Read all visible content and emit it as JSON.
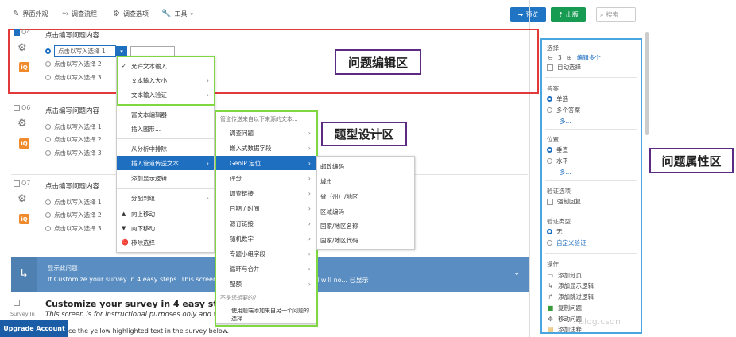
{
  "toolbar": {
    "look_feel": "界面外观",
    "survey_flow": "调查流程",
    "survey_options": "调查选项",
    "tools": "工具",
    "preview": "预览",
    "publish": "出版",
    "search_placeholder": "搜索"
  },
  "questions": [
    {
      "num": "Q4",
      "text": "点击编写问题内容",
      "choices": [
        "点击以写入选择 1",
        "点击以写入选择 2",
        "点击以写入选择 3"
      ]
    },
    {
      "num": "Q6",
      "text": "点击编写问题内容",
      "choices": [
        "点击以写入选择 1",
        "点击以写入选择 2",
        "点击以写入选择 3"
      ]
    },
    {
      "num": "Q7",
      "text": "点击编写问题内容",
      "choices": [
        "点击以写入选择 1",
        "点击以写入选择 2",
        "点击以写入选择 3"
      ]
    }
  ],
  "iq_badge": "iQ",
  "context_menu": {
    "allow_text": "允许文本输入",
    "text_size": "文本输入大小",
    "text_validation": "文本输入验证",
    "rich_editor": "富文本编辑器",
    "insert_graphic": "插入图形...",
    "remove_from_analysis": "从分析中排除",
    "insert_piped_text": "插入管道传送文本",
    "add_display_logic": "添加显示逻辑...",
    "assign_group": "分配到组",
    "move_up": "向上移动",
    "move_down": "向下移动",
    "delete_choice": "移除选择"
  },
  "piped_menu": {
    "header": "管道传送来自以下来源的文本...",
    "items": [
      "调查问题",
      "嵌入式数据字段",
      "GeoIP 定位",
      "评分",
      "调查链接",
      "日期 / 时间",
      "源订链接",
      "随机数字",
      "专题小组字段",
      "循环与合并",
      "配额"
    ],
    "not_found": "不是您想要的？",
    "tip": "使用题端添加来自另一个问题的选择..."
  },
  "geo_menu": {
    "items": [
      "邮政编码",
      "城市",
      "省（州）/地区",
      "区域编码",
      "国家/地区名称",
      "国家/地区代码"
    ]
  },
  "display_block": {
    "line1": "显示此问题：",
    "line2": "If Customize your survey in 4 easy steps. This screen is",
    "line2b": "ld will no... 已显示"
  },
  "customize": {
    "checkbox_label": "Survey In",
    "title": "Customize your survey in 4 easy steps.",
    "subtitle": "This screen is for instructional purposes only and wil",
    "line3": "ce the yellow highlighted text in the survey below."
  },
  "upgrade_label": "Upgrade Account",
  "annotations": {
    "edit_area": "问题编辑区",
    "design_area": "题型设计区",
    "property_area": "问题属性区"
  },
  "right_panel": {
    "selection_label": "选择",
    "count": "3",
    "edit_multiple": "编辑多个",
    "auto_choice": "自动选择",
    "answers_label": "答案",
    "single": "单选",
    "multiple": "多个答案",
    "more1": "多...",
    "position_label": "位置",
    "vertical": "垂直",
    "horizontal": "水平",
    "more2": "多...",
    "validation_label": "验证选项",
    "force_response": "强制回复",
    "validation_type": "验证类型",
    "none": "无",
    "custom_validation": "自定义验证",
    "actions_label": "操作",
    "add_page_break": "添加分页",
    "add_display_logic": "添加显示逻辑",
    "add_skip_logic": "添加跳过逻辑",
    "copy_question": "复制问题",
    "move_question": "移动问题",
    "add_note": "添加注释"
  },
  "watermark": "blog.csdn",
  "colors": {
    "accent_blue": "#1f74c4",
    "publish_green": "#179a51",
    "edit_red": "#e03a3a",
    "annot_green": "#7fd840",
    "annot_purple": "#5b2a82",
    "panel_blue": "#4aa6e0"
  }
}
